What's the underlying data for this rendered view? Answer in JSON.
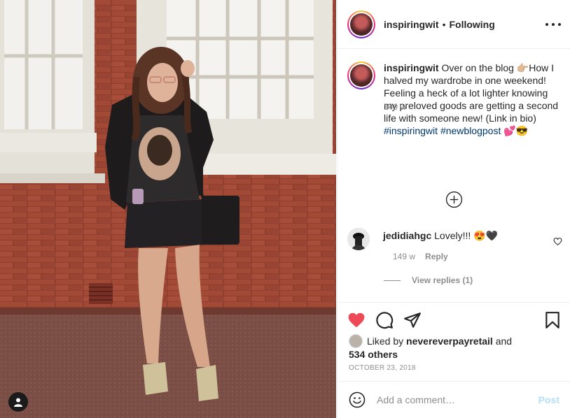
{
  "header": {
    "username": "inspiringwit",
    "separator": "•",
    "follow_status": "Following"
  },
  "caption": {
    "username": "inspiringwit",
    "text": "Over on the blog 👉🏼How I halved my wardrobe in one weekend! Feeling a heck of a lot lighter knowing my preloved goods are getting a second life with someone new! (Link in bio)",
    "hashtag1": "#inspiringwit",
    "hashtag2": "#newblogpost",
    "emoji": "💕😎",
    "time": "149 w"
  },
  "comment": {
    "username": "jedidiahgc",
    "text": "Lovely!!! 😍🖤",
    "time": "149 w",
    "reply_label": "Reply",
    "view_replies": "View replies (1)"
  },
  "likes": {
    "prefix": "Liked by",
    "user": "nevereverpayretail",
    "connector": "and",
    "others": "534 others"
  },
  "date": "OCTOBER 23, 2018",
  "add_comment": {
    "placeholder": "Add a comment…",
    "post_label": "Post"
  },
  "colors": {
    "like_red": "#ed4956",
    "link_blue": "#00376b",
    "post_disabled": "#b2dffc",
    "secondary_text": "#8e8e8e"
  },
  "icons": [
    "user-tag-icon",
    "more-options-icon",
    "load-more-comments-icon",
    "comment-like-heart-icon",
    "like-heart-icon",
    "comment-icon",
    "share-icon",
    "bookmark-icon",
    "emoji-icon"
  ]
}
